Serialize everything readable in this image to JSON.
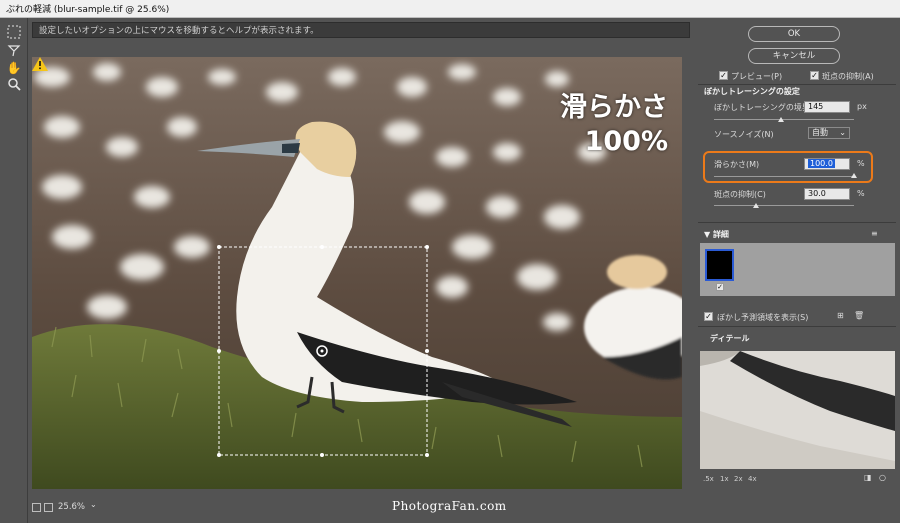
{
  "window": {
    "title": "ぶれの軽減 (blur-sample.tif @ 25.6%)"
  },
  "hint": {
    "text": "設定したいオプションの上にマウスを移動するとヘルプが表示されます。"
  },
  "overlay": {
    "line1": "滑らかさ",
    "line2": "100%"
  },
  "bottom": {
    "zoom": "25.6%",
    "watermark": "PhotograFan.com"
  },
  "panel": {
    "ok": "OK",
    "cancel": "キャンセル",
    "preview_label": "プレビュー(P)",
    "spot_suppress_label": "斑点の抑制(A)",
    "trace_header": "ぼかしトレーシングの設定",
    "blur_bounds_label": "ぼかしトレーシングの境界(B)",
    "blur_bounds_value": "145",
    "blur_bounds_unit": "px",
    "source_noise_label": "ソースノイズ(N)",
    "source_noise_value": "自動",
    "smoothing_label": "滑らかさ(M)",
    "smoothing_value": "100.0",
    "smoothing_unit": "%",
    "smoothing_level": 1.0,
    "artifact_label": "斑点の抑制(C)",
    "artifact_value": "30.0",
    "artifact_unit": "%",
    "artifact_level": 0.3,
    "blur_bounds_level": 0.48,
    "advanced_header": "詳細",
    "show_region_label": "ぼかし予測領域を表示(S)",
    "detail_header": "ディテール",
    "zoom_options": [
      ".5x",
      "1x",
      "2x",
      "4x"
    ]
  },
  "colors": {
    "highlight": "#ec7a19",
    "panel_bg": "#535353",
    "selection": "#2a5ad4"
  }
}
